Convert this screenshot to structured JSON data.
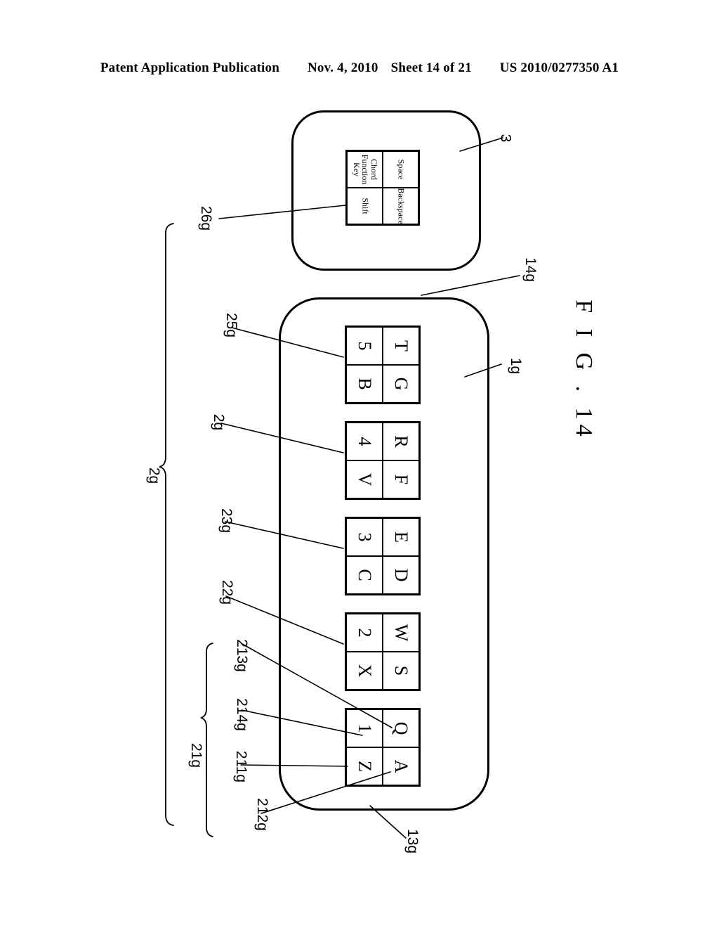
{
  "header": {
    "publication": "Patent Application Publication",
    "date": "Nov. 4, 2010",
    "sheet": "Sheet 14 of 21",
    "patent_number": "US 2010/0277350 A1"
  },
  "figure": {
    "caption": "F I G . 14",
    "orientation_note": "landscape, rotated 90 degrees clockwise"
  },
  "top_device": {
    "ref": "3",
    "panel_ref": "26g",
    "panel": {
      "rows": [
        [
          "Chord Function Key",
          "Shift"
        ],
        [
          "Space",
          "Backspace"
        ]
      ]
    }
  },
  "main_device": {
    "ref_body": "1g",
    "ref_top_edge": "14g",
    "ref_bottom_edge": "13g",
    "brace_all_keys": "2g",
    "brace_first_group": "21g",
    "key_groups": [
      {
        "ref": "21g",
        "cell_refs": [
          "211g",
          "212g",
          "213g",
          "214g"
        ],
        "rows": [
          [
            "Q",
            "1"
          ],
          [
            "A",
            "Z"
          ]
        ]
      },
      {
        "ref": "22g",
        "rows": [
          [
            "W",
            "2"
          ],
          [
            "S",
            "X"
          ]
        ]
      },
      {
        "ref": "23g",
        "rows": [
          [
            "E",
            "3"
          ],
          [
            "D",
            "C"
          ]
        ]
      },
      {
        "ref": "2g",
        "rows": [
          [
            "R",
            "4"
          ],
          [
            "F",
            "V"
          ]
        ]
      },
      {
        "ref": "25g",
        "rows": [
          [
            "T",
            "5"
          ],
          [
            "G",
            "B"
          ]
        ]
      }
    ]
  },
  "reference_numerals": {
    "n3": "3",
    "n26g": "26g",
    "n14g": "14g",
    "n25g": "25g",
    "n1g": "1g",
    "n2g_group": "2g",
    "n2g_brace": "2g",
    "n23g": "23g",
    "n22g": "22g",
    "n213g": "213g",
    "n214g": "214g",
    "n211g": "211g",
    "n21g": "21g",
    "n212g": "212g",
    "n13g": "13g"
  },
  "colors": {
    "ink": "#000000",
    "paper": "#ffffff"
  }
}
